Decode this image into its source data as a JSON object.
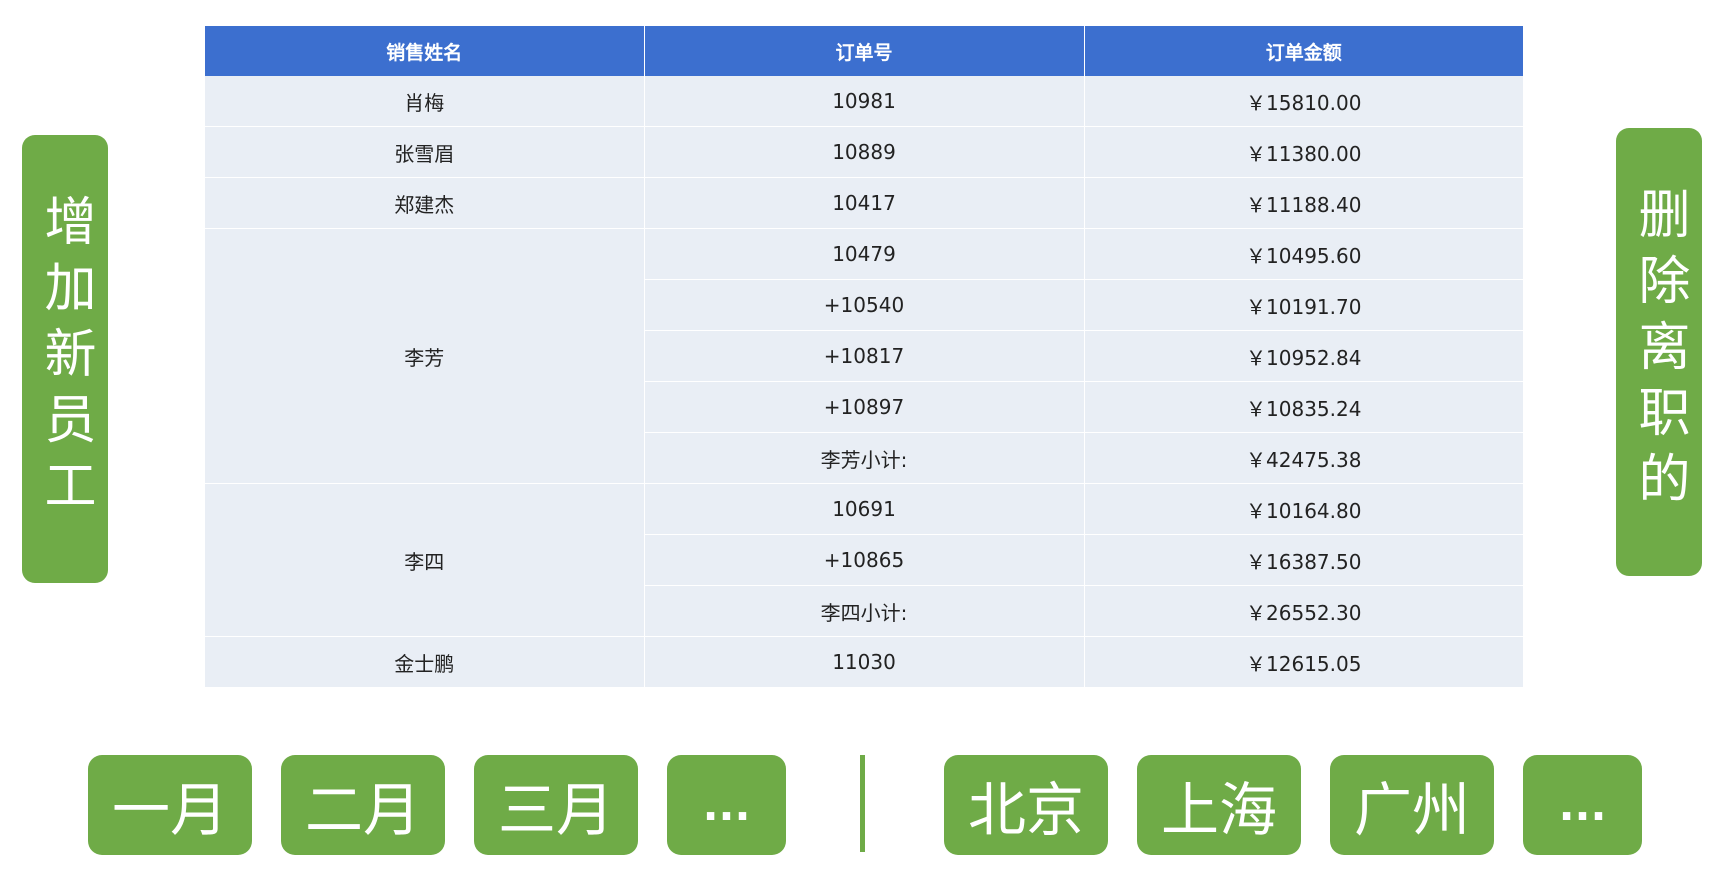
{
  "side_buttons": {
    "add": "增加新员工",
    "remove": "删除离职的"
  },
  "table": {
    "headers": [
      "销售姓名",
      "订单号",
      "订单金额"
    ],
    "rows": [
      {
        "name": "肖梅",
        "order": "10981",
        "amount": "￥15810.00"
      },
      {
        "name": "张雪眉",
        "order": "10889",
        "amount": "￥11380.00"
      },
      {
        "name": "郑建杰",
        "order": "10417",
        "amount": "￥11188.40"
      }
    ],
    "groups": [
      {
        "name": "李芳",
        "rows": [
          {
            "order": "10479",
            "amount": "￥10495.60"
          },
          {
            "order": "+10540",
            "amount": "￥10191.70"
          },
          {
            "order": "+10817",
            "amount": "￥10952.84"
          },
          {
            "order": "+10897",
            "amount": "￥10835.24"
          },
          {
            "order": "李芳小计:",
            "amount": "￥42475.38"
          }
        ]
      },
      {
        "name": "李四",
        "rows": [
          {
            "order": "10691",
            "amount": "￥10164.80"
          },
          {
            "order": "+10865",
            "amount": "￥16387.50"
          },
          {
            "order": "李四小计:",
            "amount": "￥26552.30"
          }
        ]
      }
    ],
    "last_row": {
      "name": "金士鹏",
      "order": "11030",
      "amount": "￥12615.05"
    }
  },
  "month_filters": [
    "一月",
    "二月",
    "三月",
    "..."
  ],
  "city_filters": [
    "北京",
    "上海",
    "广州",
    "..."
  ],
  "colors": {
    "header_blue": "#3c6fcf",
    "row_bg": "#e9eef5",
    "button_green": "#6fab47"
  }
}
